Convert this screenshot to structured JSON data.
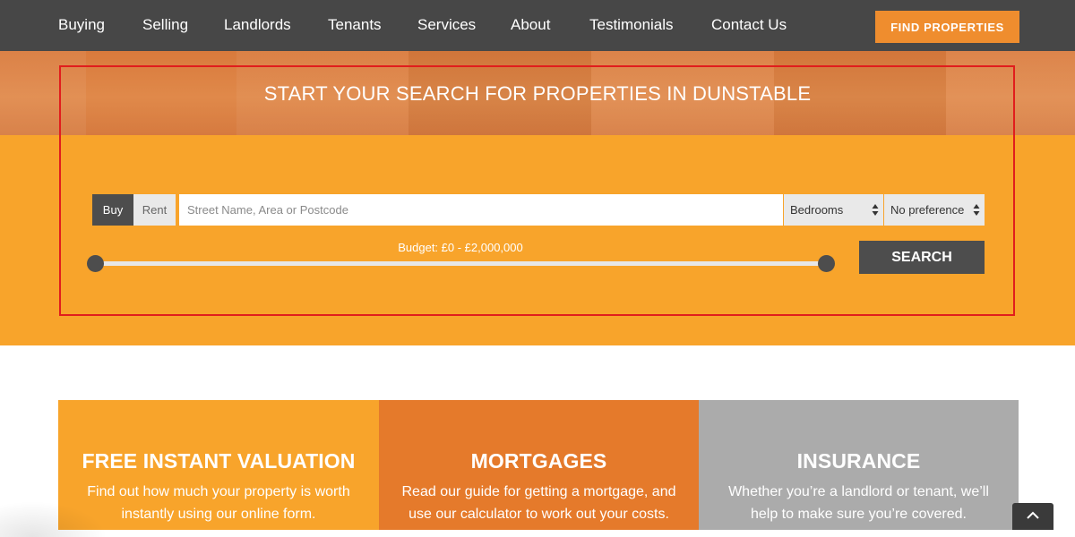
{
  "nav": {
    "items": [
      {
        "label": "Buying"
      },
      {
        "label": "Selling"
      },
      {
        "label": "Landlords"
      },
      {
        "label": "Tenants"
      },
      {
        "label": "Services"
      },
      {
        "label": "About"
      },
      {
        "label": "Testimonials"
      },
      {
        "label": "Contact Us"
      }
    ],
    "cta_label": "FIND PROPERTIES"
  },
  "hero": {
    "title": "START YOUR SEARCH FOR PROPERTIES IN DUNSTABLE"
  },
  "search": {
    "mode_buy": "Buy",
    "mode_rent": "Rent",
    "selected_mode": "Buy",
    "location_placeholder": "Street Name, Area or Postcode",
    "location_value": "",
    "bedrooms_selected": "Bedrooms",
    "preference_selected": "No preference",
    "budget_label": "Budget: £0 - £2,000,000",
    "budget_min_fraction": 0.0,
    "budget_max_fraction": 1.0,
    "submit_label": "SEARCH"
  },
  "cards": [
    {
      "title": "FREE INSTANT VALUATION",
      "text": "Find out how much your property is worth instantly using our online form."
    },
    {
      "title": "MORTGAGES",
      "text": "Read our guide for getting a mortgage, and use our calculator to work out your costs."
    },
    {
      "title": "INSURANCE",
      "text": "Whether you’re a landlord or tenant, we’ll help to make sure you’re covered."
    }
  ],
  "colors": {
    "nav_bg": "#474747",
    "accent_orange": "#f8a42b",
    "cta_orange": "#ef8d2e",
    "dark_button": "#4d4d4d",
    "mortgage_orange": "#e57a2b",
    "insurance_grey": "#ababab",
    "highlight_red": "#e11d1d"
  },
  "icons": {
    "select_arrows": "updown-arrows-icon",
    "back_to_top": "chevron-up-icon"
  }
}
